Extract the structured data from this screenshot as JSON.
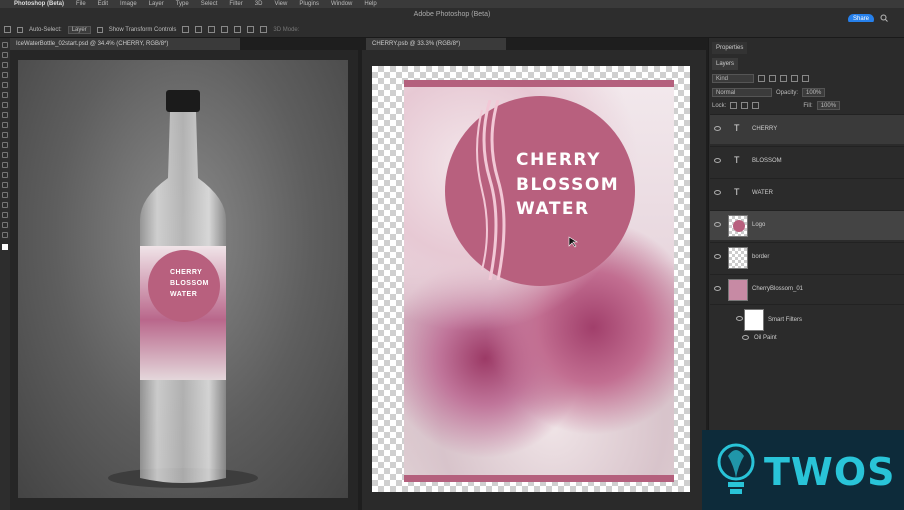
{
  "menu": [
    "Photoshop (Beta)",
    "File",
    "Edit",
    "Image",
    "Layer",
    "Type",
    "Select",
    "Filter",
    "3D",
    "View",
    "Plugins",
    "Window",
    "Help"
  ],
  "app_title": "Adobe Photoshop (Beta)",
  "share_label": "Share",
  "options": {
    "auto_select": "Auto-Select:",
    "layer_select": "Layer",
    "transform": "Show Transform Controls",
    "mode3d": "3D Mode:"
  },
  "tabs": {
    "doc1": "IceWaterBottle_02start.psd @ 34.4% (CHERRY, RGB/8*)",
    "doc2": "CHERRY.psb @ 33.3% (RGB/8*)"
  },
  "bottle_label": [
    "CHERRY",
    "BLOSSOM",
    "WATER"
  ],
  "poster_text": [
    "CHERRY",
    "BLOSSOM",
    "WATER"
  ],
  "panels": {
    "properties": "Properties",
    "layers": "Layers",
    "kind": "Kind",
    "blend": "Normal",
    "opacity_label": "Opacity:",
    "opacity": "100%",
    "lock_label": "Lock:",
    "fill_label": "Fill:",
    "fill": "100%"
  },
  "layers": [
    "CHERRY",
    "BLOSSOM",
    "WATER",
    "Logo",
    "border",
    "CherryBlossom_01",
    "Smart Filters",
    "Oil Paint"
  ],
  "logo": {
    "text": "TWOS"
  }
}
